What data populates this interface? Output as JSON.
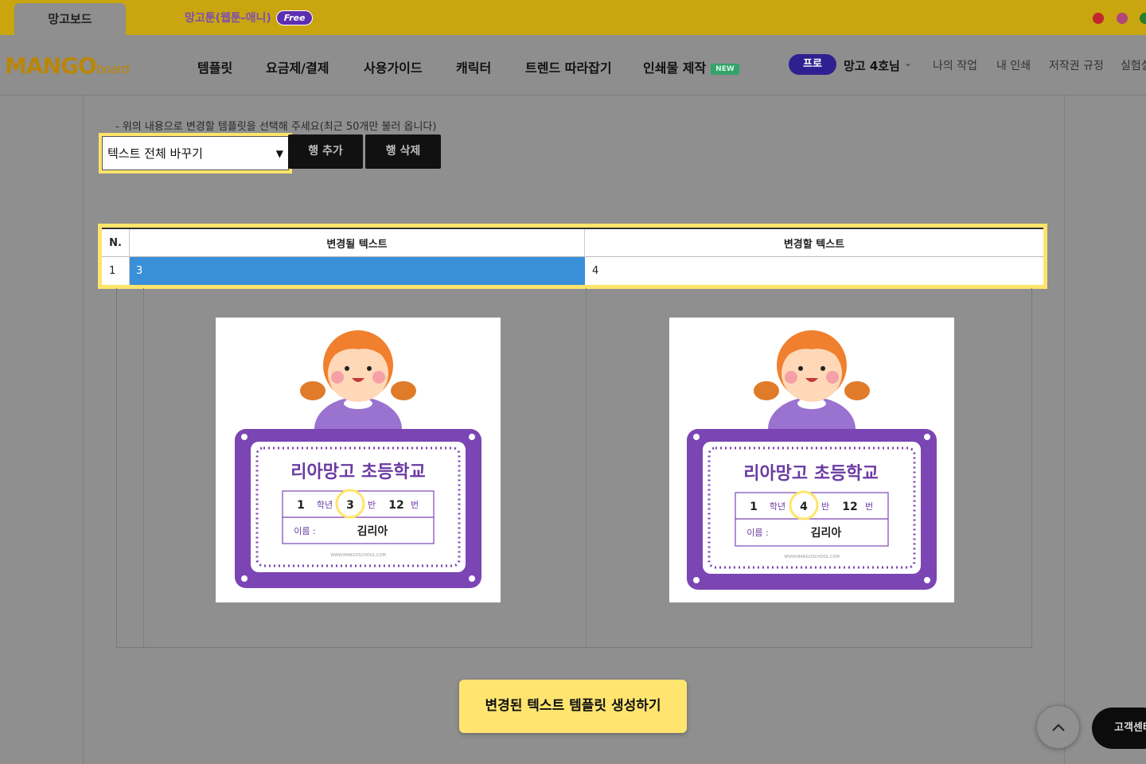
{
  "topbar": {
    "tab_board": "망고보드",
    "tab_toon": "망고툰(웹툰-애니)",
    "free_badge": "Free"
  },
  "header": {
    "logo_main": "MANGO",
    "logo_sub": "board",
    "nav": [
      "템플릿",
      "요금제/결제",
      "사용가이드",
      "캐릭터",
      "트렌드 따라잡기",
      "인쇄물 제작"
    ],
    "new_badge": "NEW",
    "pro_badge": "프로",
    "user_name": "망고 4호님",
    "util_links": [
      "나의 작업",
      "내 인쇄",
      "저작권 규정",
      "실험실"
    ]
  },
  "editor": {
    "hint": "- 위의 내용으로 변경할 템플릿을 선택해 주세요(최근 50개만 불러 옵니다)",
    "select_value": "텍스트 전체 바꾸기",
    "add_row_label": "행 추가",
    "delete_row_label": "행 삭제"
  },
  "table": {
    "headers": [
      "N.",
      "변경될 텍스트",
      "변경할 텍스트"
    ],
    "rows": [
      {
        "n": "1",
        "from": "3",
        "to": "4"
      }
    ]
  },
  "card": {
    "school": "리아망고 초등학교",
    "grade": "1",
    "grade_label": "학년",
    "class_label": "반",
    "number": "12",
    "number_label": "번",
    "name_label": "이름 :",
    "name": "김리아",
    "website": "WWW.MANGOSCHOOL.COM",
    "before_class": "3",
    "after_class": "4"
  },
  "footer": {
    "generate_label": "변경된 텍스트 템플릿 생성하기",
    "cs_label": "고객센터"
  },
  "colors": {
    "highlight": "#ffe46b",
    "selected_cell": "#3a8fd9",
    "card_purple": "#7b45b3"
  }
}
